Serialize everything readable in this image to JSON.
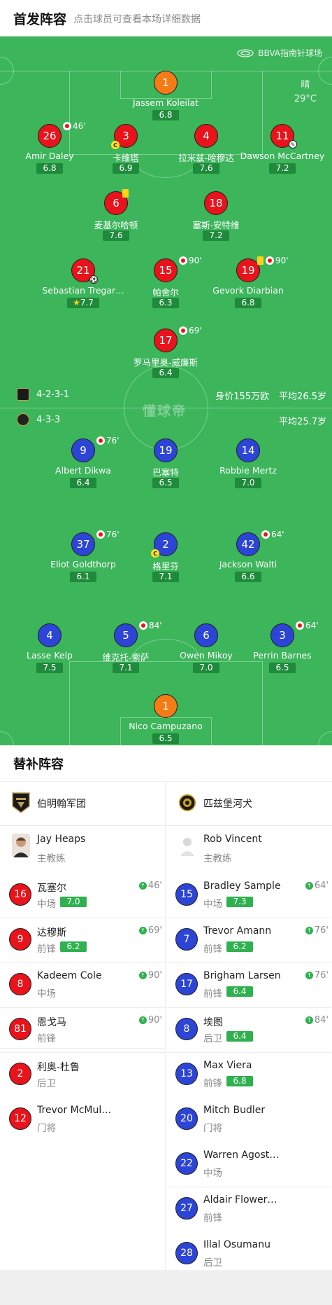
{
  "header": {
    "title": "首发阵容",
    "hint": "点击球员可查看本场详细数据"
  },
  "pitch": {
    "venue": "BBVA指南针球场",
    "weather": "晴",
    "temperature": "29°C",
    "watermark": "懂球帝",
    "colors": {
      "grass": "#3cb55b",
      "red_player": "#e8131b",
      "blue_player": "#2d45d6",
      "keeper": "#f57b16"
    },
    "home_formation": "4-2-3-1",
    "home_value": "身价155万欧",
    "home_age": "平均26.5岁",
    "away_formation": "4-3-3",
    "away_age": "平均25.7岁"
  },
  "home_players": [
    {
      "num": "1",
      "name": "Jassem Koleilat",
      "rating": "6.8"
    },
    {
      "num": "26",
      "name": "Amir Daley",
      "rating": "6.8",
      "sub": "46'"
    },
    {
      "num": "3",
      "name": "卡维塔",
      "rating": "6.9"
    },
    {
      "num": "4",
      "name": "拉米兹-哈穆达",
      "rating": "7.6"
    },
    {
      "num": "11",
      "name": "Dawson McCartney",
      "rating": "7.2"
    },
    {
      "num": "6",
      "name": "麦基尔哈顿",
      "rating": "7.6"
    },
    {
      "num": "18",
      "name": "塞斯-安特维",
      "rating": "7.2"
    },
    {
      "num": "21",
      "name": "Sebastian Tregar…",
      "rating": "7.7"
    },
    {
      "num": "15",
      "name": "帕舍尔",
      "rating": "6.3",
      "sub": "90'"
    },
    {
      "num": "19",
      "name": "Gevork Diarbian",
      "rating": "6.8",
      "sub": "90'"
    },
    {
      "num": "17",
      "name": "罗马里奥-威廉斯",
      "rating": "6.4",
      "sub": "69'"
    }
  ],
  "away_players": [
    {
      "num": "9",
      "name": "Albert Dikwa",
      "rating": "6.4",
      "sub": "76'"
    },
    {
      "num": "19",
      "name": "巴塞特",
      "rating": "6.5"
    },
    {
      "num": "14",
      "name": "Robbie Mertz",
      "rating": "7.0"
    },
    {
      "num": "37",
      "name": "Eliot Goldthorp",
      "rating": "6.1",
      "sub": "76'"
    },
    {
      "num": "2",
      "name": "格里芬",
      "rating": "7.1"
    },
    {
      "num": "42",
      "name": "Jackson Walti",
      "rating": "6.6",
      "sub": "64'"
    },
    {
      "num": "4",
      "name": "Lasse Kelp",
      "rating": "7.5"
    },
    {
      "num": "5",
      "name": "维克托-索萨",
      "rating": "7.1",
      "sub": "84'"
    },
    {
      "num": "6",
      "name": "Owen Mikoy",
      "rating": "7.0"
    },
    {
      "num": "3",
      "name": "Perrin Barnes",
      "rating": "6.5",
      "sub": "64'"
    },
    {
      "num": "1",
      "name": "Nico Campuzano",
      "rating": "6.5"
    }
  ],
  "subs": {
    "title": "替补阵容",
    "home": {
      "team": "伯明翰军团",
      "coach": {
        "name": "Jay Heaps",
        "role": "主教练"
      },
      "players": [
        {
          "num": "16",
          "name": "瓦塞尔",
          "pos": "中场",
          "rating": "7.0",
          "in": "46'"
        },
        {
          "num": "9",
          "name": "达穆斯",
          "pos": "前锋",
          "rating": "6.2",
          "in": "69'"
        },
        {
          "num": "8",
          "name": "Kadeem Cole",
          "pos": "中场",
          "in": "90'"
        },
        {
          "num": "81",
          "name": "恩戈马",
          "pos": "前锋",
          "in": "90'"
        },
        {
          "num": "2",
          "name": "利奥-杜鲁",
          "pos": "后卫"
        },
        {
          "num": "12",
          "name": "Trevor McMul…",
          "pos": "门将"
        }
      ]
    },
    "away": {
      "team": "匹兹堡河犬",
      "coach": {
        "name": "Rob Vincent",
        "role": "主教练"
      },
      "players": [
        {
          "num": "15",
          "name": "Bradley Sample",
          "pos": "中场",
          "rating": "7.3",
          "in": "64'"
        },
        {
          "num": "7",
          "name": "Trevor Amann",
          "pos": "前锋",
          "rating": "6.2",
          "in": "76'"
        },
        {
          "num": "17",
          "name": "Brigham Larsen",
          "pos": "前锋",
          "rating": "6.4",
          "in": "76'"
        },
        {
          "num": "8",
          "name": "埃图",
          "pos": "后卫",
          "rating": "6.4",
          "in": "84'"
        },
        {
          "num": "13",
          "name": "Max Viera",
          "pos": "前锋",
          "rating": "6.8"
        },
        {
          "num": "20",
          "name": "Mitch Budler",
          "pos": "门将"
        },
        {
          "num": "22",
          "name": "Warren Agost…",
          "pos": "中场"
        },
        {
          "num": "27",
          "name": "Aldair Flower…",
          "pos": "前锋"
        },
        {
          "num": "28",
          "name": "Illal Osumanu",
          "pos": "后卫"
        }
      ]
    }
  }
}
